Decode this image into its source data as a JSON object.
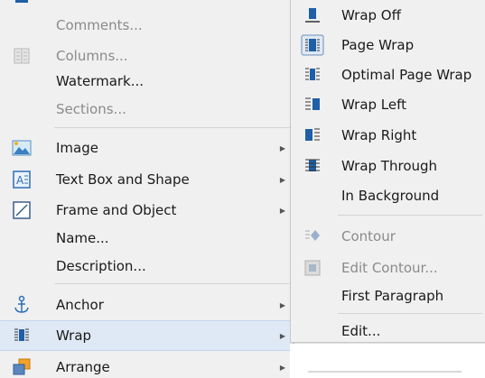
{
  "main_menu": {
    "items": [
      {
        "label": "Comments...",
        "disabled": true,
        "icon": "none",
        "submenu": false
      },
      {
        "label": "Columns...",
        "disabled": true,
        "icon": "columns-icon",
        "submenu": false
      },
      {
        "label": "Watermark...",
        "disabled": false,
        "icon": "none",
        "submenu": false
      },
      {
        "label": "Sections...",
        "disabled": true,
        "icon": "none",
        "submenu": false
      },
      {
        "label": "Image",
        "disabled": false,
        "icon": "image-icon",
        "submenu": true
      },
      {
        "label": "Text Box and Shape",
        "disabled": false,
        "icon": "text-box-icon",
        "submenu": true
      },
      {
        "label": "Frame and Object",
        "disabled": false,
        "icon": "frame-icon",
        "submenu": true
      },
      {
        "label": "Name...",
        "disabled": false,
        "icon": "none",
        "submenu": false
      },
      {
        "label": "Description...",
        "disabled": false,
        "icon": "none",
        "submenu": false
      },
      {
        "label": "Anchor",
        "disabled": false,
        "icon": "anchor-icon",
        "submenu": true
      },
      {
        "label": "Wrap",
        "disabled": false,
        "icon": "wrap-icon",
        "submenu": true,
        "highlighted": true
      },
      {
        "label": "Arrange",
        "disabled": false,
        "icon": "arrange-icon",
        "submenu": true
      }
    ]
  },
  "wrap_submenu": {
    "items": [
      {
        "label": "Wrap Off",
        "disabled": false,
        "icon": "wrap-off-icon"
      },
      {
        "label": "Page Wrap",
        "disabled": false,
        "icon": "page-wrap-icon",
        "checked": true
      },
      {
        "label": "Optimal Page Wrap",
        "disabled": false,
        "icon": "optimal-wrap-icon"
      },
      {
        "label": "Wrap Left",
        "disabled": false,
        "icon": "wrap-left-icon"
      },
      {
        "label": "Wrap Right",
        "disabled": false,
        "icon": "wrap-right-icon"
      },
      {
        "label": "Wrap Through",
        "disabled": false,
        "icon": "wrap-through-icon"
      },
      {
        "label": "In Background",
        "disabled": false,
        "icon": "none"
      },
      {
        "label": "Contour",
        "disabled": true,
        "icon": "contour-icon"
      },
      {
        "label": "Edit Contour...",
        "disabled": true,
        "icon": "edit-contour-icon"
      },
      {
        "label": "First Paragraph",
        "disabled": false,
        "icon": "none"
      },
      {
        "label": "Edit...",
        "disabled": false,
        "icon": "none"
      }
    ]
  },
  "colors": {
    "menu_bg": "#f0f0f0",
    "highlight_bg": "#dfe9f5",
    "icon_blue": "#1e5fa8",
    "disabled_text": "#8a8a8a"
  }
}
